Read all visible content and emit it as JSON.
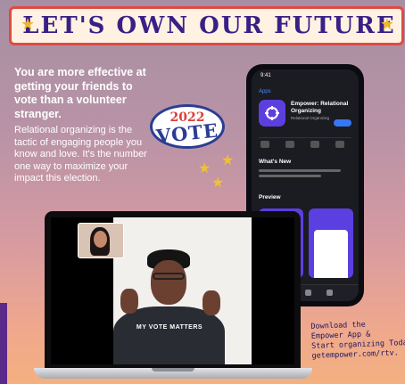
{
  "banner": {
    "title": "LET'S OWN OUR FUTURE",
    "star_left": "★",
    "star_right": "★"
  },
  "copy": {
    "headline": "You are more effective at getting your friends to vote than a volunteer stranger.",
    "body": "Relational organizing is the tactic of engaging people you know and love. It's the number one way to maximize your impact this election."
  },
  "badge": {
    "year": "2022",
    "word": "VOTE"
  },
  "decor": {
    "star": "★"
  },
  "phone": {
    "status_time": "9:41",
    "back_label": "Apps",
    "app_name": "Empower: Relational Organizing",
    "app_subtitle": "Relational Organizing",
    "whats_new": "What's New",
    "preview_label": "Preview"
  },
  "video": {
    "shirt_text": "MY VOTE MATTERS"
  },
  "callout": {
    "line1": "Download the",
    "line2": "Empower App &",
    "line3": "Start organizing Today",
    "line4": "getempower.com/rtv."
  },
  "colors": {
    "banner_text": "#3a1f86",
    "banner_border": "#e04a44",
    "star": "#f0b72a",
    "app_icon": "#5d3fe0"
  }
}
